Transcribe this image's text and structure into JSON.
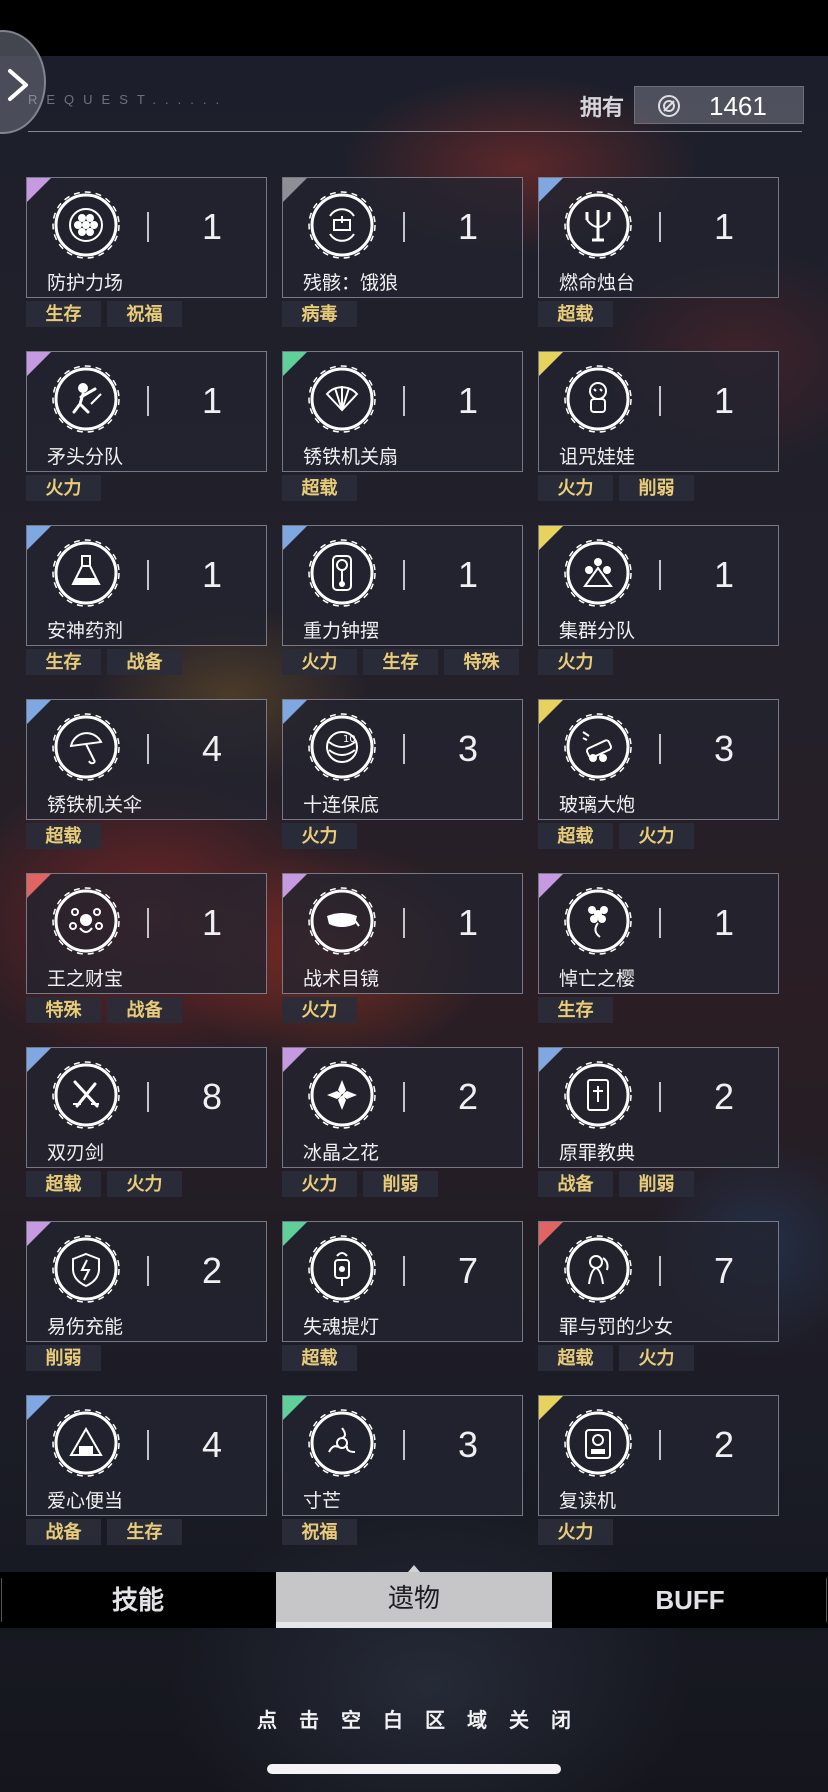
{
  "header": {
    "request_text": "REQUEST......",
    "own_label": "拥有",
    "currency_value": "1461",
    "currency_icon": "gear-coin-icon"
  },
  "relics": [
    {
      "name": "防护力场",
      "count": "1",
      "icon": "hexagon-shield-icon",
      "rarity_color": "#c69ae0",
      "tags": [
        "生存",
        "祝福"
      ]
    },
    {
      "name": "残骸：饿狼",
      "count": "1",
      "icon": "wreck-wolf-icon",
      "rarity_color": "#8e8e96",
      "tags": [
        "病毒"
      ]
    },
    {
      "name": "燃命烛台",
      "count": "1",
      "icon": "candelabrum-icon",
      "rarity_color": "#7fa8e2",
      "tags": [
        "超载"
      ]
    },
    {
      "name": "矛头分队",
      "count": "1",
      "icon": "spearhead-soldier-icon",
      "rarity_color": "#c69ae0",
      "tags": [
        "火力"
      ]
    },
    {
      "name": "锈铁机关扇",
      "count": "1",
      "icon": "iron-fan-icon",
      "rarity_color": "#5fd09a",
      "tags": [
        "超载"
      ]
    },
    {
      "name": "诅咒娃娃",
      "count": "1",
      "icon": "voodoo-doll-icon",
      "rarity_color": "#e8d25e",
      "tags": [
        "火力",
        "削弱"
      ]
    },
    {
      "name": "安神药剂",
      "count": "1",
      "icon": "potion-flask-icon",
      "rarity_color": "#7fa8e2",
      "tags": [
        "生存",
        "战备"
      ]
    },
    {
      "name": "重力钟摆",
      "count": "1",
      "icon": "pendulum-clock-icon",
      "rarity_color": "#7fa8e2",
      "tags": [
        "火力",
        "生存",
        "特殊"
      ]
    },
    {
      "name": "集群分队",
      "count": "1",
      "icon": "cluster-squad-icon",
      "rarity_color": "#e8d25e",
      "tags": [
        "火力"
      ]
    },
    {
      "name": "锈铁机关伞",
      "count": "4",
      "icon": "iron-umbrella-icon",
      "rarity_color": "#7fa8e2",
      "tags": [
        "超载"
      ]
    },
    {
      "name": "十连保底",
      "count": "3",
      "icon": "ten-pull-icon",
      "rarity_color": "#7fa8e2",
      "tags": [
        "火力"
      ]
    },
    {
      "name": "玻璃大炮",
      "count": "3",
      "icon": "glass-cannon-icon",
      "rarity_color": "#e8d25e",
      "tags": [
        "超载",
        "火力"
      ]
    },
    {
      "name": "王之财宝",
      "count": "1",
      "icon": "king-treasure-icon",
      "rarity_color": "#e06464",
      "tags": [
        "特殊",
        "战备"
      ]
    },
    {
      "name": "战术目镜",
      "count": "1",
      "icon": "tactical-visor-icon",
      "rarity_color": "#c69ae0",
      "tags": [
        "火力"
      ]
    },
    {
      "name": "悼亡之樱",
      "count": "1",
      "icon": "cherry-blossom-icon",
      "rarity_color": "#c69ae0",
      "tags": [
        "生存"
      ]
    },
    {
      "name": "双刃剑",
      "count": "8",
      "icon": "double-blade-icon",
      "rarity_color": "#7fa8e2",
      "tags": [
        "超载",
        "火力"
      ]
    },
    {
      "name": "冰晶之花",
      "count": "2",
      "icon": "ice-flower-icon",
      "rarity_color": "#c69ae0",
      "tags": [
        "火力",
        "削弱"
      ]
    },
    {
      "name": "原罪教典",
      "count": "2",
      "icon": "scripture-book-icon",
      "rarity_color": "#7fa8e2",
      "tags": [
        "战备",
        "削弱"
      ]
    },
    {
      "name": "易伤充能",
      "count": "2",
      "icon": "broken-shield-icon",
      "rarity_color": "#c69ae0",
      "tags": [
        "削弱"
      ]
    },
    {
      "name": "失魂提灯",
      "count": "7",
      "icon": "lantern-icon",
      "rarity_color": "#5fd09a",
      "tags": [
        "超载"
      ]
    },
    {
      "name": "罪与罚的少女",
      "count": "7",
      "icon": "girl-portrait-icon",
      "rarity_color": "#e06464",
      "tags": [
        "超载",
        "火力"
      ]
    },
    {
      "name": "爱心便当",
      "count": "4",
      "icon": "rice-ball-icon",
      "rarity_color": "#7fa8e2",
      "tags": [
        "战备",
        "生存"
      ]
    },
    {
      "name": "寸芒",
      "count": "3",
      "icon": "triple-blade-icon",
      "rarity_color": "#5fd09a",
      "tags": [
        "祝福"
      ]
    },
    {
      "name": "复读机",
      "count": "2",
      "icon": "cassette-player-icon",
      "rarity_color": "#e8d25e",
      "tags": [
        "火力"
      ]
    }
  ],
  "tabs": {
    "skills": "技能",
    "relics": "遗物",
    "buff": "BUFF",
    "active": "relics"
  },
  "close_hint": "点击空白区域关闭"
}
